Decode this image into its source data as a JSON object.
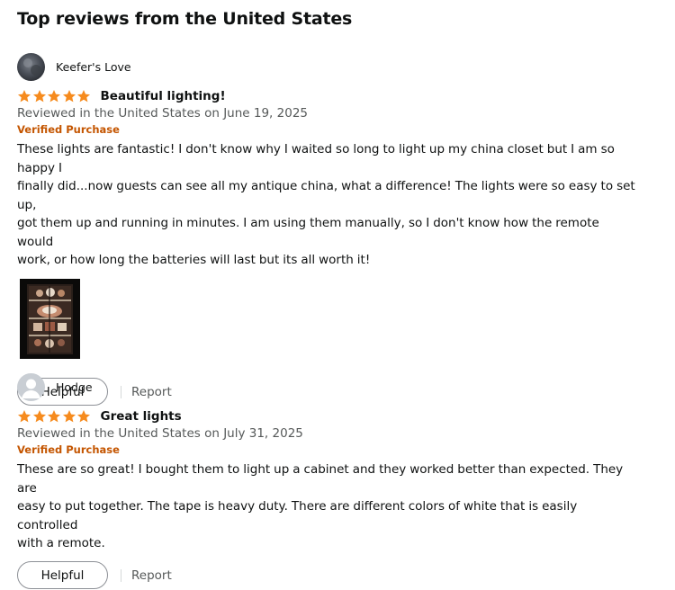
{
  "section_title": "Top reviews from the United States",
  "colors": {
    "star": "#ff9900",
    "verified": "#c45500",
    "meta_text": "#565959",
    "button_border": "#8d9096"
  },
  "reviews": [
    {
      "reviewer_name": "Keefer's Love",
      "avatar_icon": "user-photo-avatar",
      "rating": 5,
      "title": "Beautiful lighting!",
      "meta": "Reviewed in the United States on June 19, 2025",
      "verified_label": "Verified Purchase",
      "lines": [
        "These lights are fantastic! I don't know why I waited so long to light up my china closet but I am so happy I",
        "finally did...now guests can see all my antique china, what a difference! The lights were so easy to set up,",
        "got them up and running in minutes. I am using them manually, so I don't know how the remote would",
        "work, or how long the batteries will last but its all worth it!"
      ],
      "has_image": true,
      "helpful_label": "Helpful",
      "report_label": "Report"
    },
    {
      "reviewer_name": "Hodge",
      "avatar_icon": "default-user-avatar",
      "rating": 5,
      "title": "Great lights",
      "meta": "Reviewed in the United States on July 31, 2025",
      "verified_label": "Verified Purchase",
      "lines": [
        "These are so great! I bought them to light up a cabinet and they worked better than expected. They are",
        "easy to put together. The tape is heavy duty. There are different colors of white that is easily controlled",
        "with a remote."
      ],
      "has_image": false,
      "helpful_label": "Helpful",
      "report_label": "Report"
    }
  ]
}
